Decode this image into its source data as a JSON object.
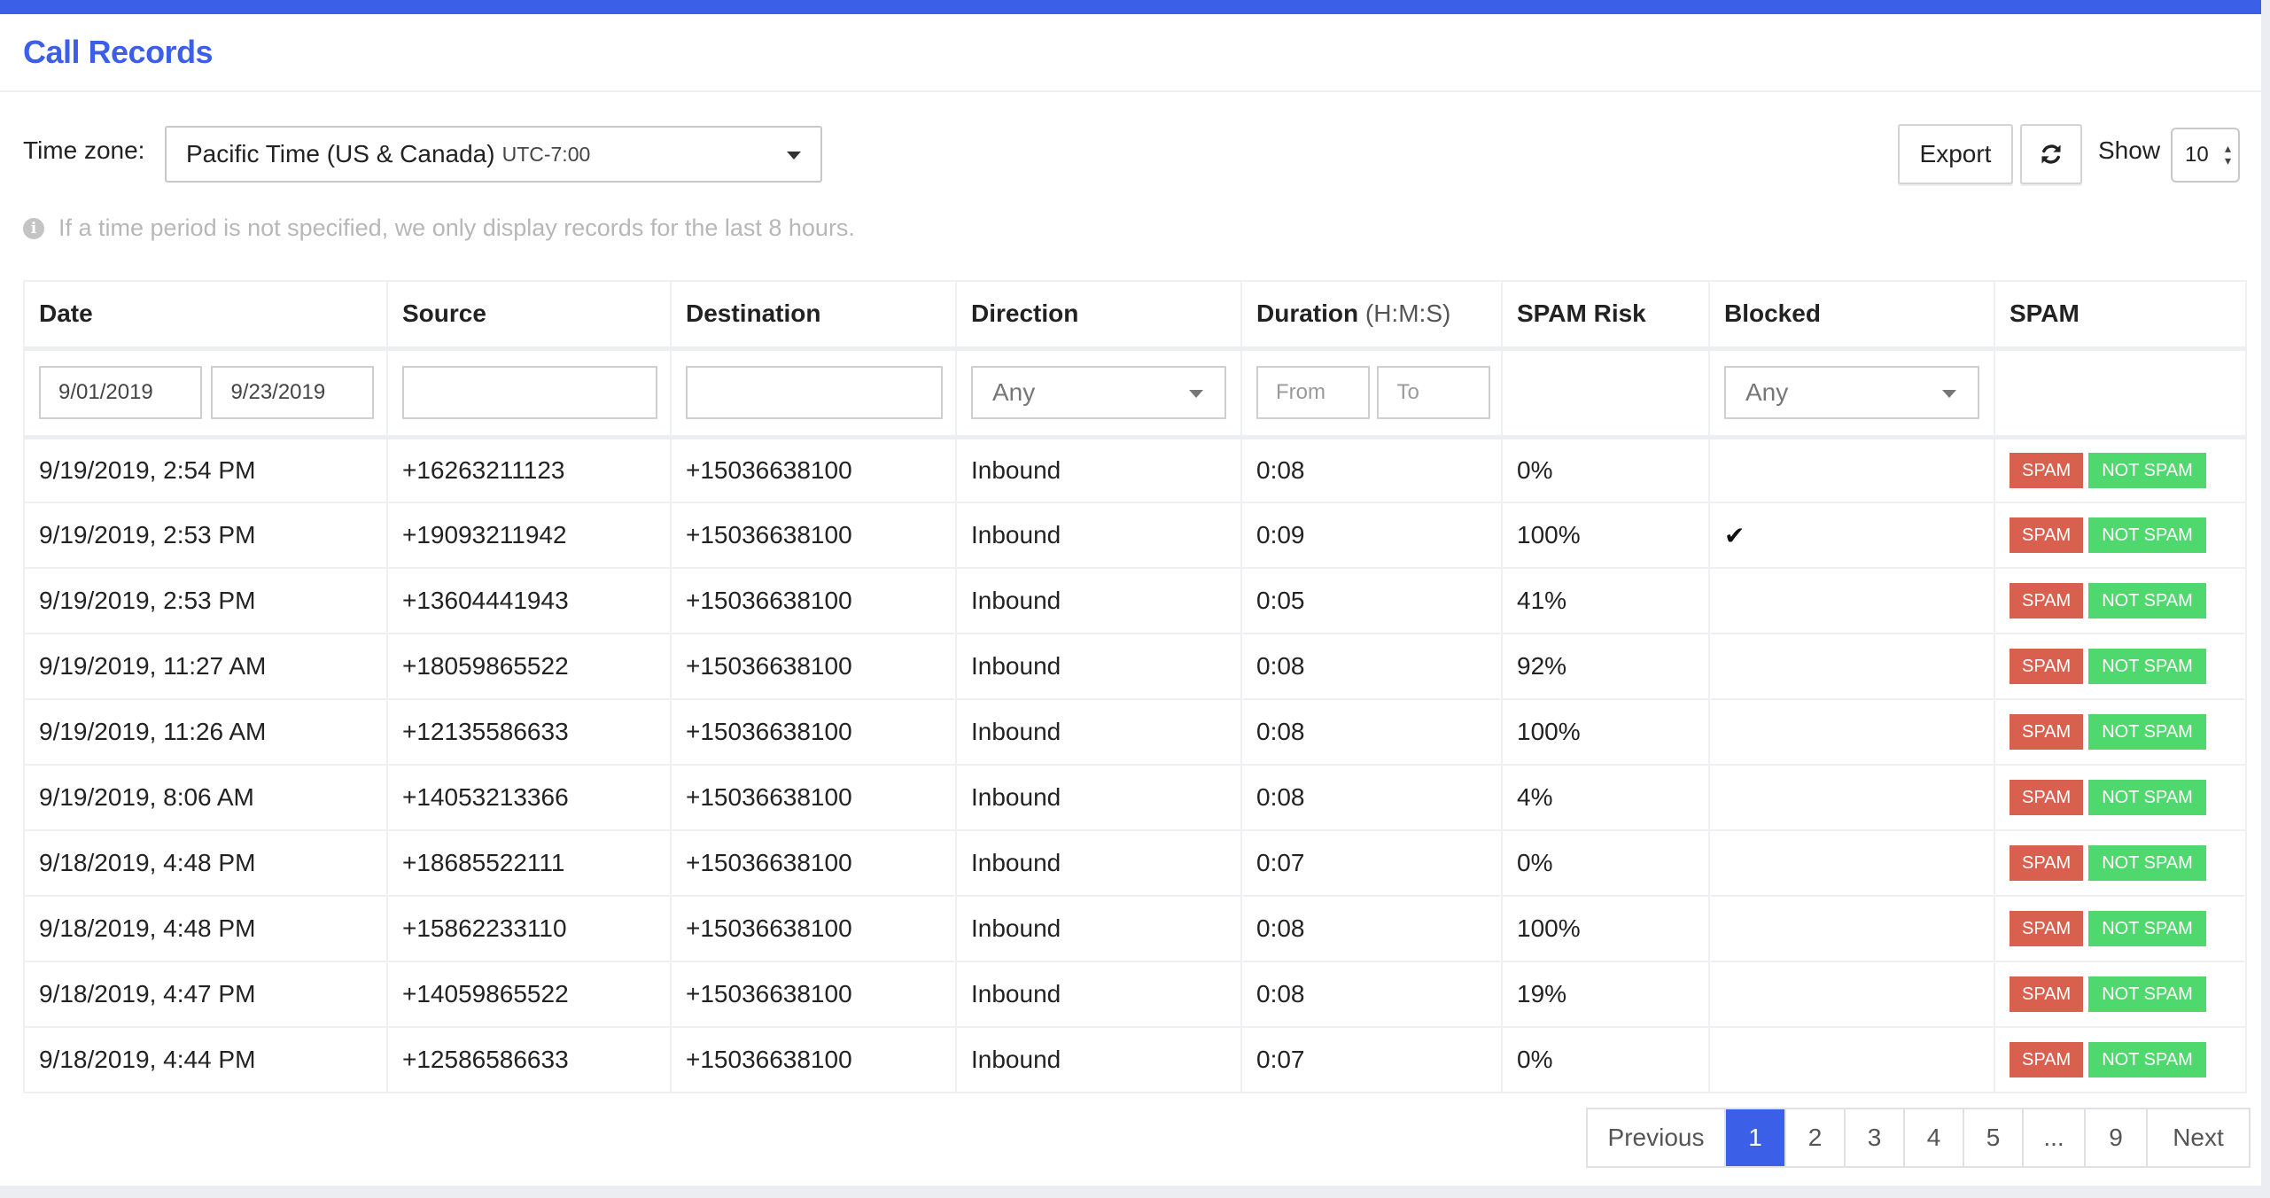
{
  "header": {
    "title": "Call Records"
  },
  "toolbar": {
    "timezone_label": "Time zone:",
    "timezone_value": "Pacific Time (US & Canada)",
    "timezone_offset": "UTC-7:00",
    "export_label": "Export",
    "refresh_icon": "refresh-icon",
    "show_label": "Show",
    "page_size": "10"
  },
  "notice": {
    "icon": "info-icon",
    "text": "If a time period is not specified, we only display records for the last 8 hours."
  },
  "table": {
    "columns": [
      "Date",
      "Source",
      "Destination",
      "Direction",
      "Duration",
      "SPAM Risk",
      "Blocked",
      "SPAM"
    ],
    "duration_unit": "(H:M:S)",
    "filters": {
      "date_from": "9/01/2019",
      "date_to": "9/23/2019",
      "source": "",
      "destination": "",
      "direction": "Any",
      "duration_from_placeholder": "From",
      "duration_to_placeholder": "To",
      "blocked": "Any"
    },
    "rows": [
      {
        "date": "9/19/2019, 2:54 PM",
        "source": "+16263211123",
        "destination": "+15036638100",
        "direction": "Inbound",
        "duration": "0:08",
        "spam_risk": "0%",
        "blocked": ""
      },
      {
        "date": "9/19/2019, 2:53 PM",
        "source": "+19093211942",
        "destination": "+15036638100",
        "direction": "Inbound",
        "duration": "0:09",
        "spam_risk": "100%",
        "blocked": "✔"
      },
      {
        "date": "9/19/2019, 2:53 PM",
        "source": "+13604441943",
        "destination": "+15036638100",
        "direction": "Inbound",
        "duration": "0:05",
        "spam_risk": "41%",
        "blocked": ""
      },
      {
        "date": "9/19/2019, 11:27 AM",
        "source": "+18059865522",
        "destination": "+15036638100",
        "direction": "Inbound",
        "duration": "0:08",
        "spam_risk": "92%",
        "blocked": ""
      },
      {
        "date": "9/19/2019, 11:26 AM",
        "source": "+12135586633",
        "destination": "+15036638100",
        "direction": "Inbound",
        "duration": "0:08",
        "spam_risk": "100%",
        "blocked": ""
      },
      {
        "date": "9/19/2019, 8:06 AM",
        "source": "+14053213366",
        "destination": "+15036638100",
        "direction": "Inbound",
        "duration": "0:08",
        "spam_risk": "4%",
        "blocked": ""
      },
      {
        "date": "9/18/2019, 4:48 PM",
        "source": "+18685522111",
        "destination": "+15036638100",
        "direction": "Inbound",
        "duration": "0:07",
        "spam_risk": "0%",
        "blocked": ""
      },
      {
        "date": "9/18/2019, 4:48 PM",
        "source": "+15862233110",
        "destination": "+15036638100",
        "direction": "Inbound",
        "duration": "0:08",
        "spam_risk": "100%",
        "blocked": ""
      },
      {
        "date": "9/18/2019, 4:47 PM",
        "source": "+14059865522",
        "destination": "+15036638100",
        "direction": "Inbound",
        "duration": "0:08",
        "spam_risk": "19%",
        "blocked": ""
      },
      {
        "date": "9/18/2019, 4:44 PM",
        "source": "+12586586633",
        "destination": "+15036638100",
        "direction": "Inbound",
        "duration": "0:07",
        "spam_risk": "0%",
        "blocked": ""
      }
    ],
    "spam_label": "SPAM",
    "not_spam_label": "NOT SPAM"
  },
  "pagination": {
    "previous": "Previous",
    "pages": [
      "1",
      "2",
      "3",
      "4",
      "5",
      "...",
      "9"
    ],
    "active": "1",
    "next": "Next"
  },
  "colors": {
    "accent": "#3b5fe6",
    "spam": "#d9604f",
    "not_spam": "#4fd86e"
  }
}
